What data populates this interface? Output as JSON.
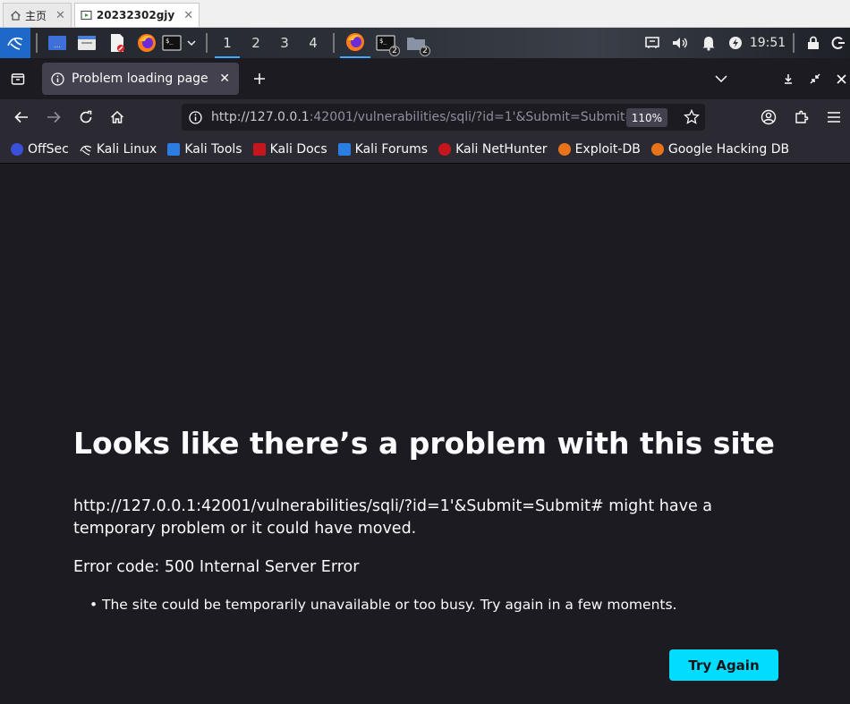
{
  "vm_tabs": [
    {
      "label": "主页",
      "icon": "home-icon",
      "active": false
    },
    {
      "label": "20232302gjy",
      "icon": "vm-icon",
      "active": true
    }
  ],
  "panel": {
    "workspaces": [
      "1",
      "2",
      "3",
      "4"
    ],
    "active_workspace": "1",
    "terminal_badge": "2",
    "files_badge": "2",
    "clock": "19:51"
  },
  "browser": {
    "tab_title": "Problem loading page",
    "url_host": "http://127.0.0.1",
    "url_rest": ":42001/vulnerabilities/sqli/?id=1'&Submit=Submit#",
    "zoom": "110%",
    "bookmarks": [
      {
        "label": "OffSec",
        "color": "#3b4fd8"
      },
      {
        "label": "Kali Linux",
        "color": "#1c1b22"
      },
      {
        "label": "Kali Tools",
        "color": "#2a7de1"
      },
      {
        "label": "Kali Docs",
        "color": "#c5161d"
      },
      {
        "label": "Kali Forums",
        "color": "#2a7de1"
      },
      {
        "label": "Kali NetHunter",
        "color": "#c5161d"
      },
      {
        "label": "Exploit-DB",
        "color": "#e8731b"
      },
      {
        "label": "Google Hacking DB",
        "color": "#e8731b"
      }
    ]
  },
  "error_page": {
    "title": "Looks like there’s a problem with this site",
    "message": "http://127.0.0.1:42001/vulnerabilities/sqli/?id=1'&Submit=Submit# might have a temporary problem or it could have moved.",
    "error_code": "Error code: 500 Internal Server Error",
    "bullets": [
      "The site could be temporarily unavailable or too busy. Try again in a few moments."
    ],
    "button_label": "Try Again",
    "accent_color": "#00ddff"
  }
}
